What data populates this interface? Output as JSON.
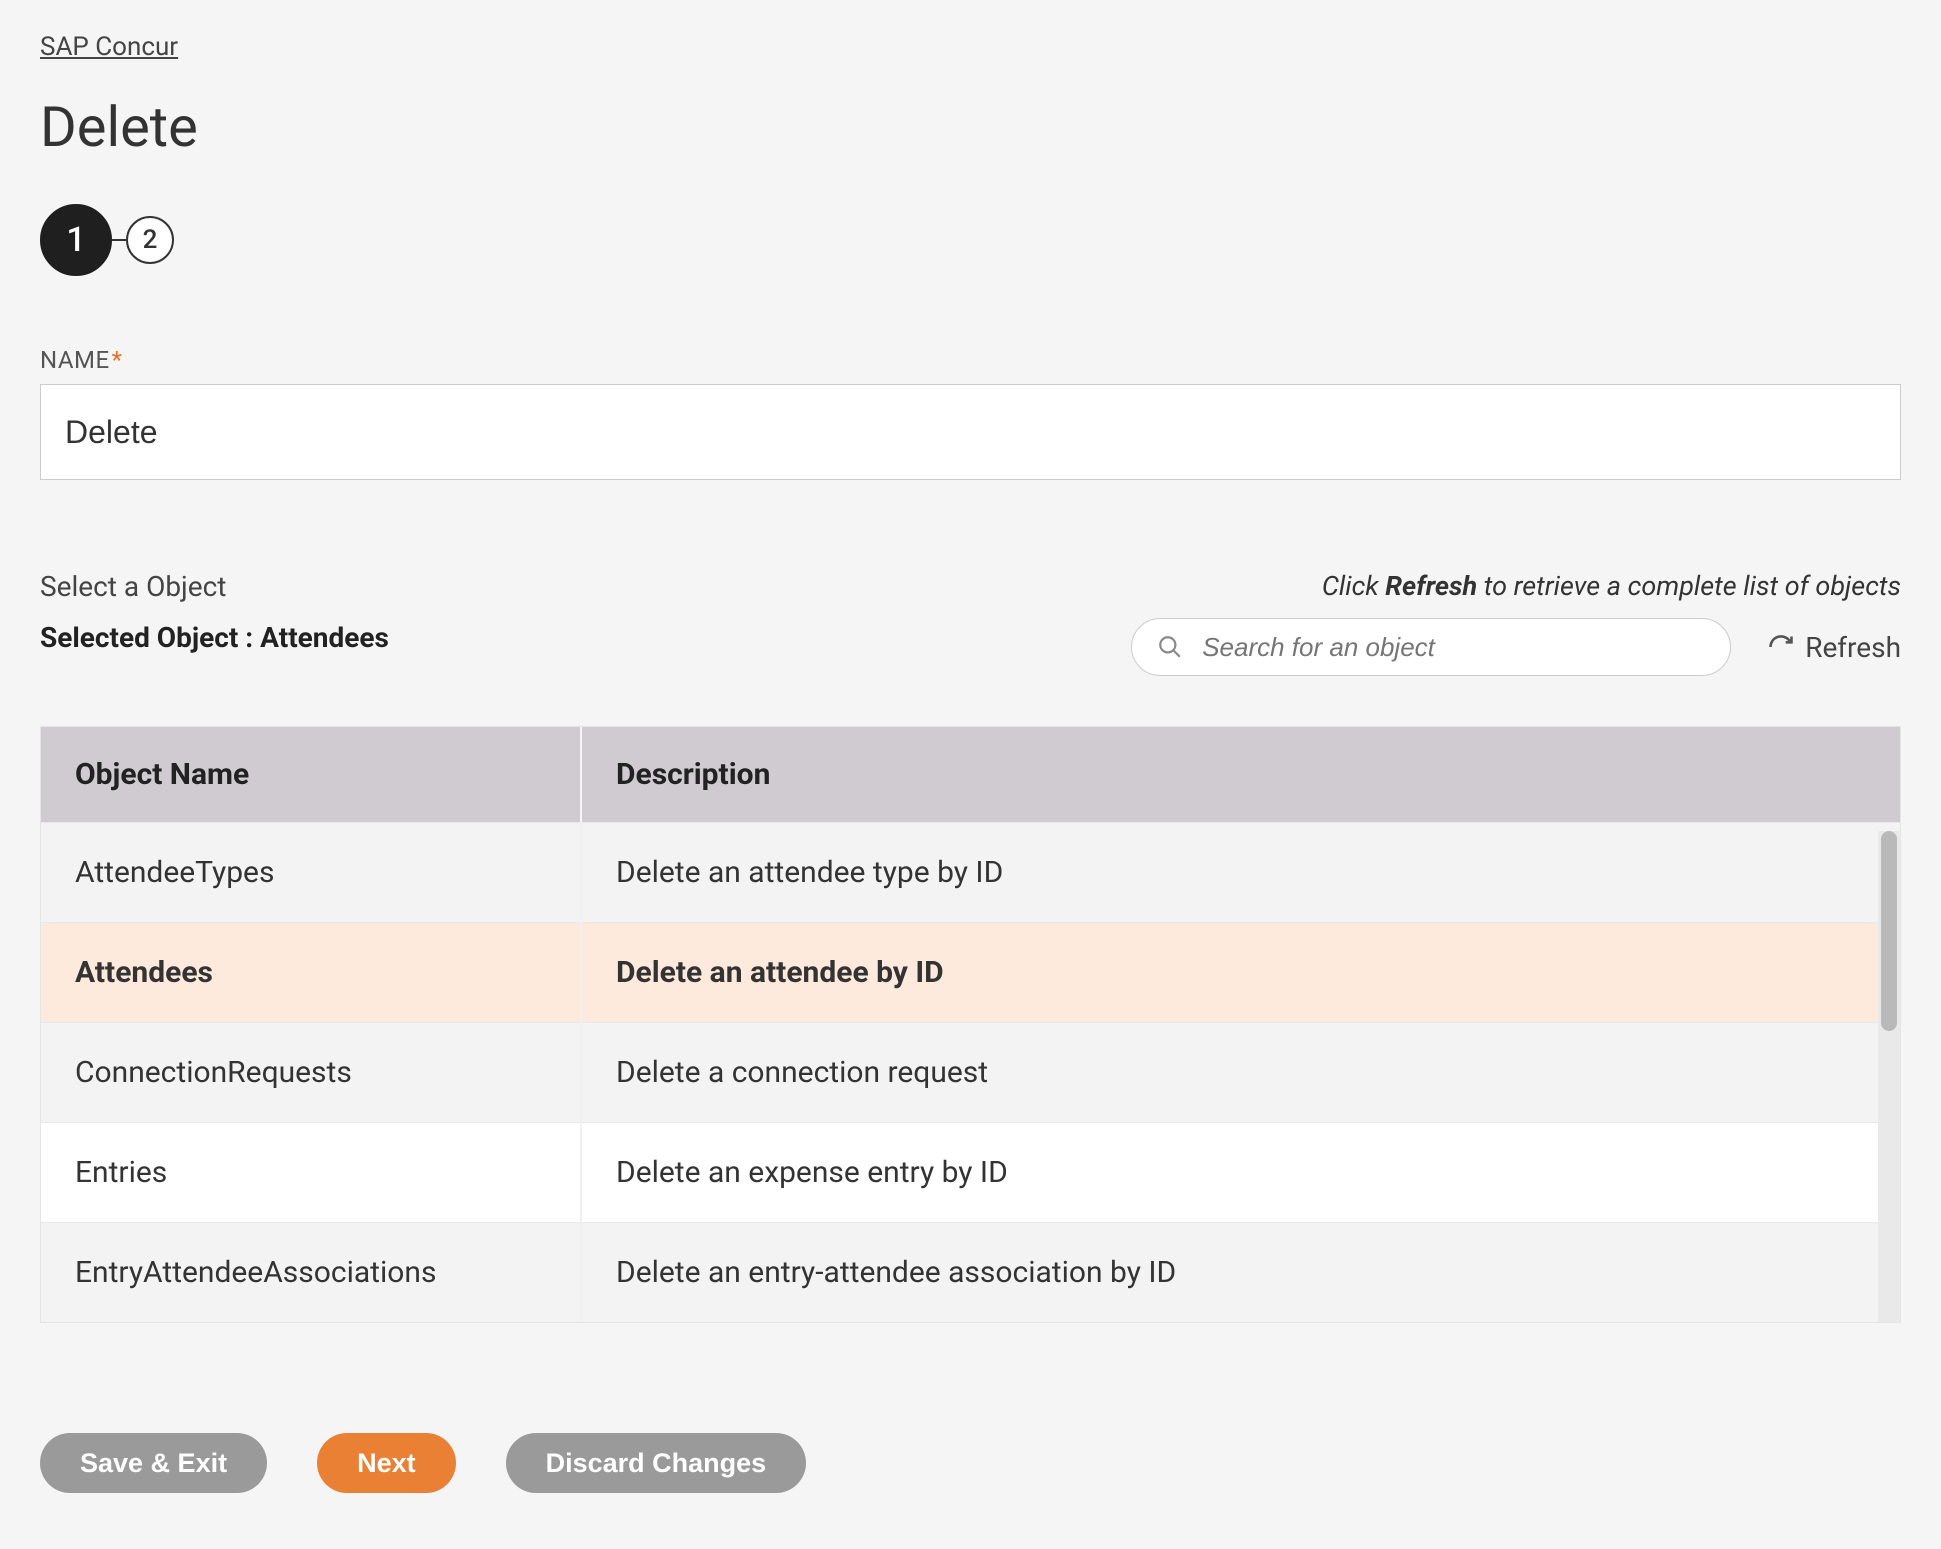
{
  "breadcrumb": "SAP Concur",
  "page_title": "Delete",
  "stepper": {
    "steps": [
      "1",
      "2"
    ],
    "active_index": 0
  },
  "name_field": {
    "label": "NAME",
    "required_marker": "*",
    "value": "Delete"
  },
  "object_section": {
    "select_label": "Select a Object",
    "selected_prefix": "Selected Object : ",
    "selected_object": "Attendees",
    "hint_prefix": "Click ",
    "hint_bold": "Refresh",
    "hint_suffix": " to retrieve a complete list of objects",
    "search_placeholder": "Search for an object",
    "refresh_label": "Refresh"
  },
  "table": {
    "headers": {
      "name": "Object Name",
      "description": "Description"
    },
    "rows": [
      {
        "name": "AttendeeTypes",
        "description": "Delete an attendee type by ID",
        "selected": false
      },
      {
        "name": "Attendees",
        "description": "Delete an attendee by ID",
        "selected": true
      },
      {
        "name": "ConnectionRequests",
        "description": "Delete a connection request",
        "selected": false
      },
      {
        "name": "Entries",
        "description": "Delete an expense entry by ID",
        "selected": false
      },
      {
        "name": "EntryAttendeeAssociations",
        "description": "Delete an entry-attendee association by ID",
        "selected": false
      }
    ]
  },
  "footer": {
    "save_exit": "Save & Exit",
    "next": "Next",
    "discard": "Discard Changes"
  }
}
